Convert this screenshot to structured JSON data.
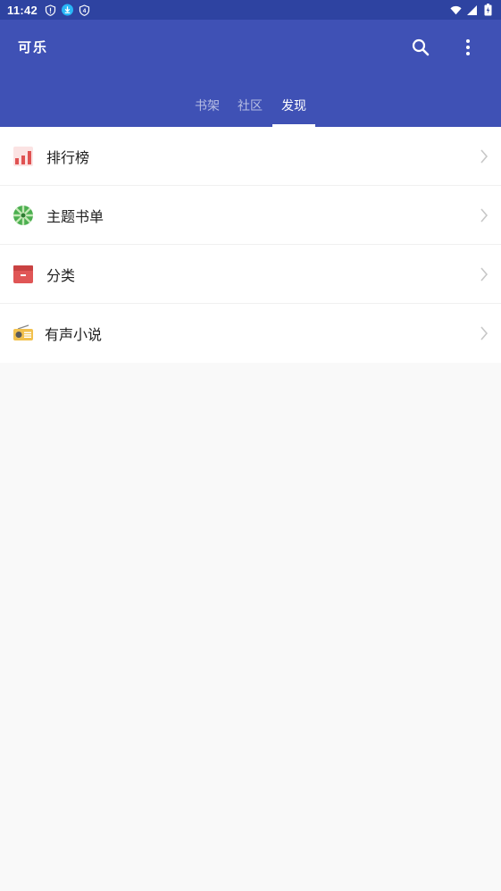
{
  "status_bar": {
    "time": "11:42"
  },
  "app_bar": {
    "title": "可乐",
    "tabs": [
      {
        "label": "书架"
      },
      {
        "label": "社区"
      },
      {
        "label": "发现"
      }
    ],
    "active_tab": "发现"
  },
  "icons": {
    "search": "search-icon",
    "more": "more-vert-icon",
    "chevron": "chevron-right-icon"
  },
  "discover_list": [
    {
      "label": "排行榜",
      "icon": "ranking-chart-icon"
    },
    {
      "label": "主题书单",
      "icon": "theme-list-icon"
    },
    {
      "label": "分类",
      "icon": "category-box-icon"
    },
    {
      "label": "有声小说",
      "icon": "radio-icon"
    }
  ],
  "colors": {
    "primary": "#3f51b5",
    "status_bar": "#2e43a1",
    "background": "#f9f9f9"
  }
}
